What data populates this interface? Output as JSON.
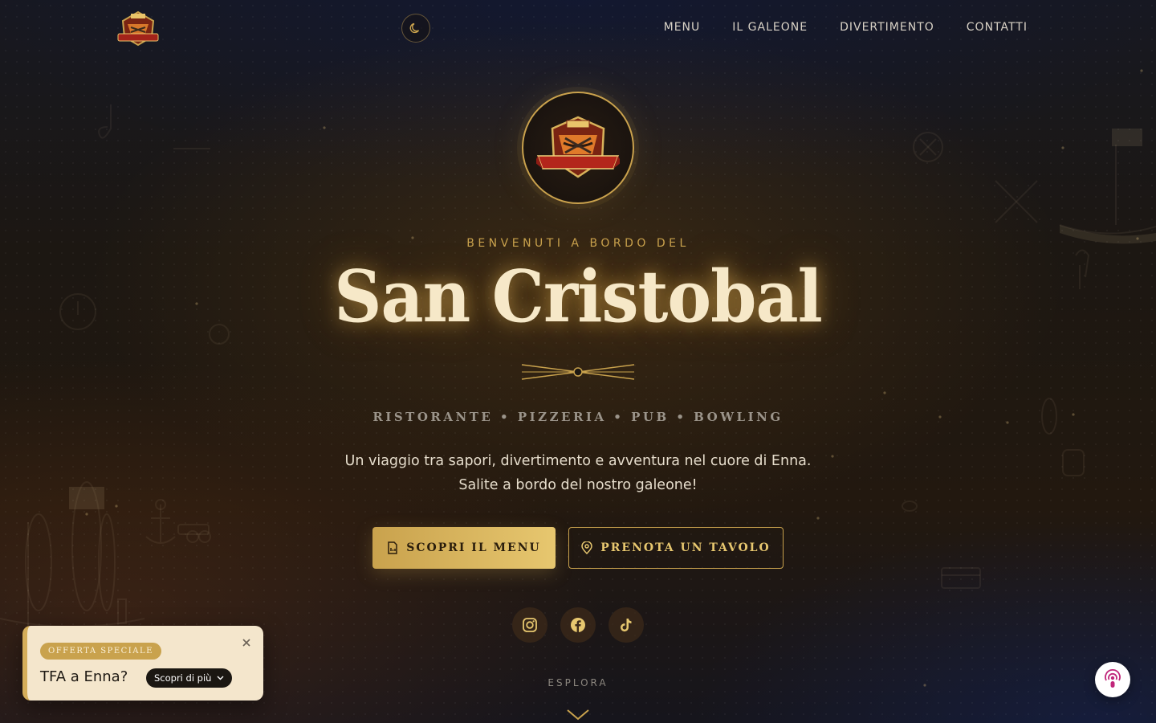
{
  "nav": {
    "items": [
      {
        "label": "MENU"
      },
      {
        "label": "IL GALEONE"
      },
      {
        "label": "DIVERTIMENTO"
      },
      {
        "label": "CONTATTI"
      }
    ],
    "logo_text": "San Cristobal"
  },
  "hero": {
    "welcome": "BENVENUTI A BORDO DEL",
    "title": "San Cristobal",
    "subtitle": "RISTORANTE • PIZZERIA • PUB • BOWLING",
    "intro_line1": "Un viaggio tra sapori, divertimento e avventura nel cuore di Enna.",
    "intro_line2": "Salite a bordo del nostro galeone!",
    "primary_button": "SCOPRI IL MENU",
    "secondary_button": "PRENOTA UN TAVOLO",
    "socials": [
      "instagram-icon",
      "facebook-icon",
      "tiktok-icon"
    ],
    "explore": "ESPLORA"
  },
  "promo": {
    "badge": "OFFERTA SPECIALE",
    "title": "TFA a Enna?",
    "button": "Scopri di più"
  },
  "colors": {
    "accent_gold": "#c9a24d",
    "light_gold": "#e7c76f",
    "cream": "#f4e6cc"
  }
}
